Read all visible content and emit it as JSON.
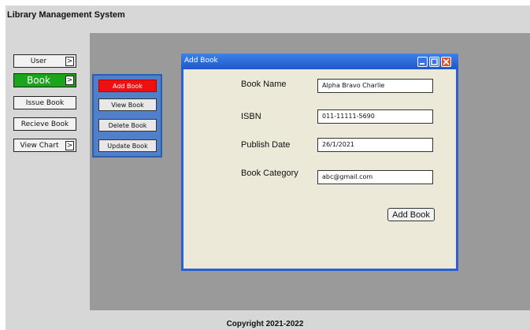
{
  "app": {
    "title": "Library Management System",
    "footer": "Copyright 2021-2022"
  },
  "sidebar": {
    "arrow": ">",
    "items": [
      {
        "label": "User",
        "has_arrow": true
      },
      {
        "label": "Book",
        "has_arrow": true,
        "active": true,
        "color": "#1aa51a"
      },
      {
        "label": "Issue Book"
      },
      {
        "label": "Recieve Book"
      },
      {
        "label": "View Chart",
        "has_arrow": true
      }
    ]
  },
  "submenu": {
    "items": [
      {
        "label": "Add Book",
        "selected": true,
        "color": "#f01010"
      },
      {
        "label": "View Book"
      },
      {
        "label": "Delete Book"
      },
      {
        "label": "Update Book"
      }
    ]
  },
  "dialog": {
    "title": "Add Book",
    "fields": [
      {
        "label": "Book Name",
        "value": "Alpha Bravo Charlie"
      },
      {
        "label": "ISBN",
        "value": "011-11111-5690"
      },
      {
        "label": "Publish Date",
        "value": "26/1/2021"
      },
      {
        "label": "Book Category",
        "value": "abc@gmail.com"
      }
    ],
    "submit_label": "Add Book",
    "title_color": "#2b5fd3"
  }
}
